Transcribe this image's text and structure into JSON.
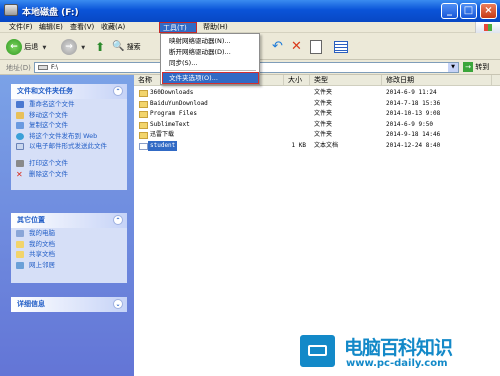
{
  "window": {
    "title": "本地磁盘 (F:)",
    "minimize": "_",
    "maximize": "□",
    "close": "×"
  },
  "menubar": {
    "file": "文件(F)",
    "edit": "编辑(E)",
    "view": "查看(V)",
    "favorites": "收藏(A)",
    "tools": "工具(T)",
    "help": "帮助(H)"
  },
  "toolbar": {
    "back": "后退",
    "back_glyph": "←",
    "forward_glyph": "→",
    "up_glyph": "⬆",
    "search": "搜索",
    "search_glyph": "🔍",
    "undo_glyph": "↶",
    "delete_glyph": "✕"
  },
  "address": {
    "label": "地址(D)",
    "value": "F:\\",
    "go": "转到",
    "go_glyph": "→"
  },
  "tools_menu": {
    "items": [
      "映射网络驱动器(N)...",
      "断开网络驱动器(D)...",
      "同步(S)...",
      "文件夹选项(O)..."
    ],
    "highlighted_index": 3
  },
  "side_panel": {
    "tasks": {
      "title": "文件和文件夹任务",
      "items": [
        "重命名这个文件",
        "移动这个文件",
        "复制这个文件",
        "将这个文件发布到 Web",
        "以电子邮件形式发送此文件",
        "打印这个文件",
        "删除这个文件"
      ]
    },
    "other": {
      "title": "其它位置",
      "items": [
        "我的电脑",
        "我的文档",
        "共享文档",
        "网上邻居"
      ]
    },
    "details": {
      "title": "详细信息"
    },
    "chevron_glyph": "⌃",
    "chevron_down_glyph": "⌄"
  },
  "file_list": {
    "columns": {
      "name": "名称",
      "size": "大小",
      "type": "类型",
      "date": "修改日期"
    },
    "rows": [
      {
        "name": "360Downloads",
        "size": "",
        "type": "文件夹",
        "date": "2014-6-9 11:24"
      },
      {
        "name": "BaiduYunDownload",
        "size": "",
        "type": "文件夹",
        "date": "2014-7-18 15:36"
      },
      {
        "name": "Program Files",
        "size": "",
        "type": "文件夹",
        "date": "2014-10-13 9:08"
      },
      {
        "name": "SublimeText",
        "size": "",
        "type": "文件夹",
        "date": "2014-6-9 9:50"
      },
      {
        "name": "迅雷下载",
        "size": "",
        "type": "文件夹",
        "date": "2014-9-18 14:46"
      },
      {
        "name": "student",
        "size": "1 KB",
        "type": "文本文档",
        "date": "2014-12-24 8:40"
      }
    ],
    "selected_index": 5
  },
  "watermark": {
    "brand_cn": "电脑百科知识",
    "brand_en": "www.pc-daily.com"
  },
  "colors": {
    "title_bar": "#0a54d8",
    "side_panel": "#7ba2e7",
    "selection": "#316ac5",
    "highlight_border": "#d32f2f",
    "watermark": "#1389c8"
  }
}
